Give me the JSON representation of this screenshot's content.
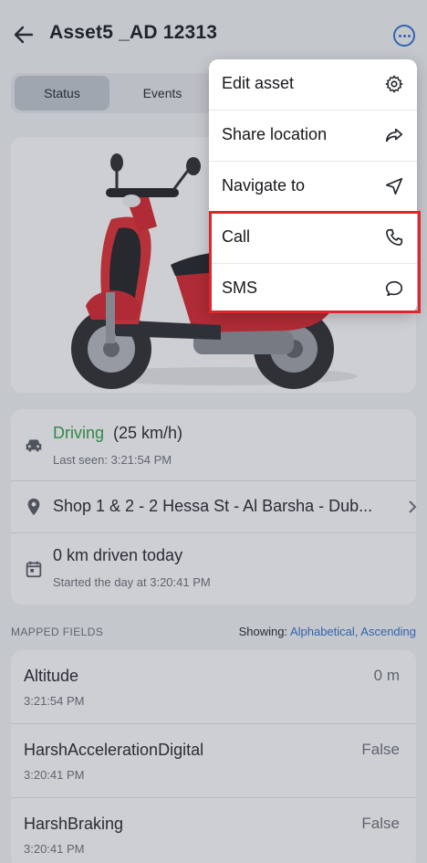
{
  "header": {
    "title": "Asset5 _AD 12313",
    "back_icon": "arrow-left-icon",
    "more_icon": "more-horizontal-icon"
  },
  "tabs": [
    {
      "label": "Status",
      "active": true
    },
    {
      "label": "Events",
      "active": false
    }
  ],
  "status": {
    "driving": {
      "state": "Driving",
      "speed": "(25 km/h)",
      "last_seen": "Last seen: 3:21:54 PM"
    },
    "location": {
      "address": "Shop 1 & 2 - 2 Hessa St - Al Barsha - Dub..."
    },
    "distance": {
      "text": "0 km driven today",
      "started": "Started the day at 3:20:41 PM"
    }
  },
  "mapped_fields": {
    "label": "MAPPED FIELDS",
    "showing_label": "Showing:",
    "sort_value": "Alphabetical, Ascending",
    "items": [
      {
        "name": "Altitude",
        "time": "3:21:54 PM",
        "value": "0 m"
      },
      {
        "name": "HarshAccelerationDigital",
        "time": "3:20:41 PM",
        "value": "False"
      },
      {
        "name": "HarshBraking",
        "time": "3:20:41 PM",
        "value": "False"
      }
    ]
  },
  "menu": {
    "items": [
      {
        "label": "Edit asset",
        "icon": "gear-icon"
      },
      {
        "label": "Share location",
        "icon": "share-icon"
      },
      {
        "label": "Navigate to",
        "icon": "navigate-icon"
      },
      {
        "label": "Call",
        "icon": "phone-icon"
      },
      {
        "label": "SMS",
        "icon": "message-icon"
      }
    ]
  },
  "colors": {
    "accent": "#2d6fcf",
    "driving": "#2ea043",
    "highlight": "#e0262b"
  }
}
